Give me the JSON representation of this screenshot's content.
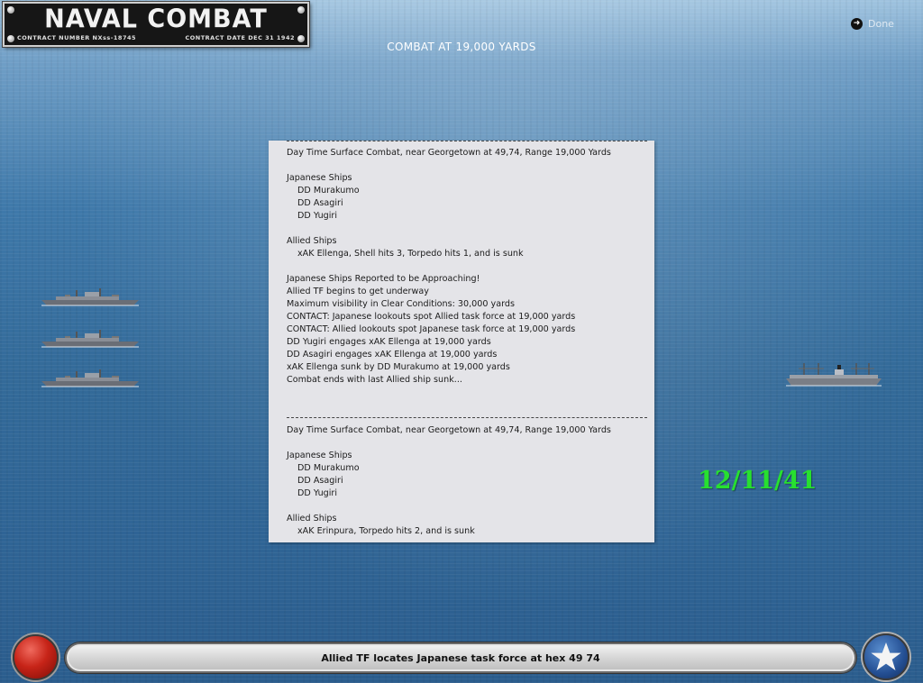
{
  "header": {
    "title": "NAVAL COMBAT",
    "contract_number": "CONTRACT NUMBER   NXss-18745",
    "contract_date": "CONTRACT DATE  DEC 31  1942",
    "combat_heading": "COMBAT AT 19,000 YARDS",
    "done_label": "Done",
    "done_icon": "arrow-right-icon"
  },
  "report": {
    "lines": [
      {
        "type": "sep"
      },
      {
        "type": "text",
        "text": "Day Time Surface Combat, near Georgetown at 49,74, Range 19,000 Yards"
      },
      {
        "type": "blank"
      },
      {
        "type": "text",
        "text": "Japanese Ships"
      },
      {
        "type": "indent",
        "text": "DD Murakumo"
      },
      {
        "type": "indent",
        "text": "DD Asagiri"
      },
      {
        "type": "indent",
        "text": "DD Yugiri"
      },
      {
        "type": "blank"
      },
      {
        "type": "text",
        "text": "Allied Ships"
      },
      {
        "type": "indent",
        "text": "xAK Ellenga, Shell hits 3, Torpedo hits 1, and is sunk"
      },
      {
        "type": "blank"
      },
      {
        "type": "text",
        "text": "Japanese Ships Reported to be Approaching!"
      },
      {
        "type": "text",
        "text": "Allied TF begins to get underway"
      },
      {
        "type": "text",
        "text": "Maximum visibility in Clear Conditions: 30,000 yards"
      },
      {
        "type": "text",
        "text": "CONTACT: Japanese lookouts spot Allied task force at 19,000 yards"
      },
      {
        "type": "text",
        "text": "CONTACT: Allied lookouts spot Japanese task force at 19,000 yards"
      },
      {
        "type": "text",
        "text": "DD Yugiri engages xAK Ellenga at 19,000 yards"
      },
      {
        "type": "text",
        "text": "DD Asagiri engages xAK Ellenga at 19,000 yards"
      },
      {
        "type": "text",
        "text": "xAK Ellenga sunk by DD Murakumo at 19,000 yards"
      },
      {
        "type": "text",
        "text": "Combat ends with last Allied ship sunk..."
      },
      {
        "type": "blank"
      },
      {
        "type": "blank"
      },
      {
        "type": "sep2"
      },
      {
        "type": "text",
        "text": "Day Time Surface Combat, near Georgetown at 49,74, Range 19,000 Yards"
      },
      {
        "type": "blank"
      },
      {
        "type": "text",
        "text": "Japanese Ships"
      },
      {
        "type": "indent",
        "text": "DD Murakumo"
      },
      {
        "type": "indent",
        "text": "DD Asagiri"
      },
      {
        "type": "indent",
        "text": "DD Yugiri"
      },
      {
        "type": "blank"
      },
      {
        "type": "text",
        "text": "Allied Ships"
      },
      {
        "type": "indent",
        "text": "xAK Erinpura, Torpedo hits 2, and is sunk"
      }
    ]
  },
  "date": "12/11/41",
  "status_message": "Allied TF locates Japanese task force at hex 49 74",
  "colors": {
    "date_green": "#27e02f",
    "panel_bg": "#e4e4e8",
    "sea": "#336a99"
  },
  "icons": {
    "left_button": "red-ball-button",
    "right_button": "star-roundel-icon"
  }
}
